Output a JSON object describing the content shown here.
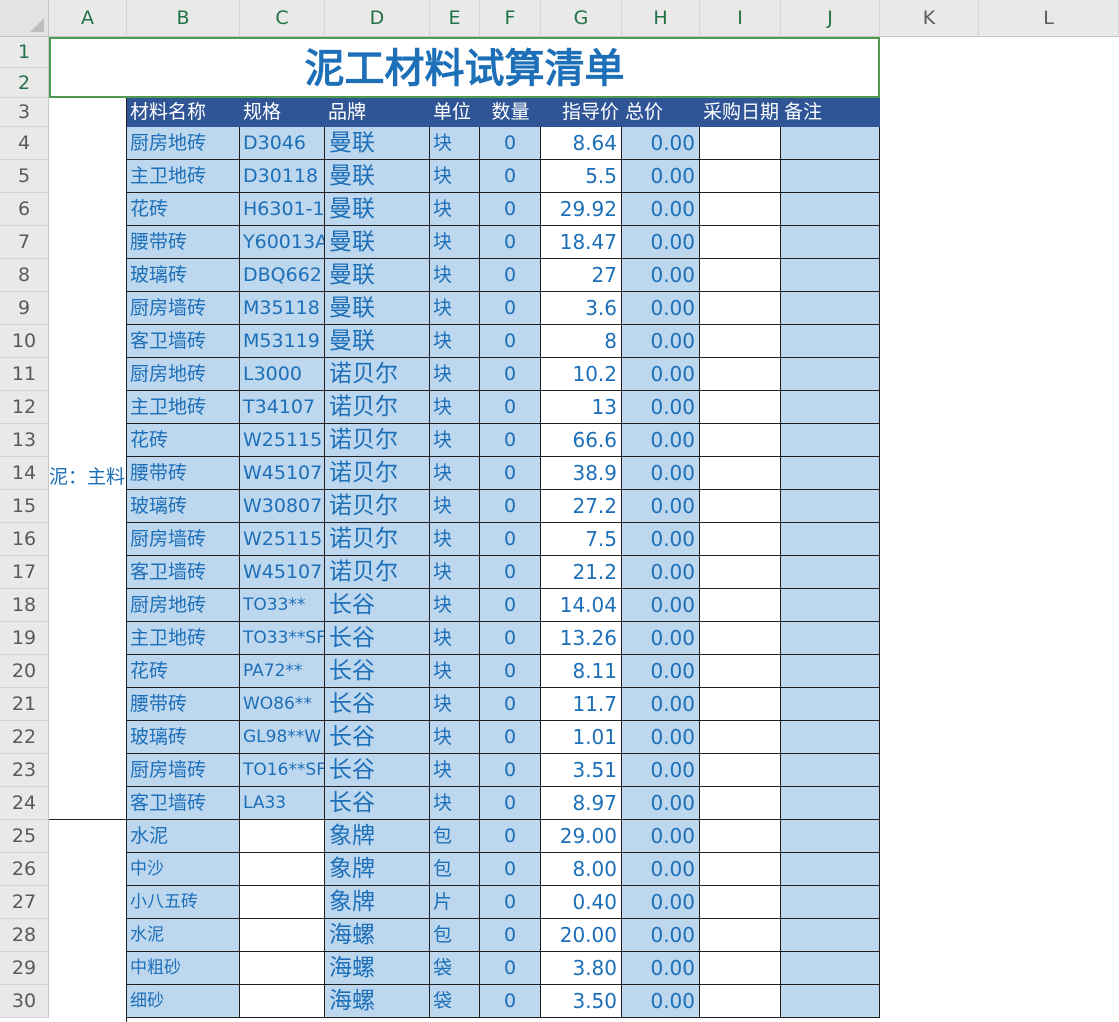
{
  "columns": [
    "A",
    "B",
    "C",
    "D",
    "E",
    "F",
    "G",
    "H",
    "I",
    "J",
    "K",
    "L"
  ],
  "row_numbers": [
    "1",
    "2",
    "3",
    "4",
    "5",
    "6",
    "7",
    "8",
    "9",
    "10",
    "11",
    "12",
    "13",
    "14",
    "15",
    "16",
    "17",
    "18",
    "19",
    "20",
    "21",
    "22",
    "23",
    "24",
    "25",
    "26",
    "27",
    "28",
    "29",
    "30"
  ],
  "sheet_title": "泥工材料试算清单",
  "headers": [
    "材料名称",
    "规格",
    "品牌",
    "单位",
    "数量",
    "指导价",
    "总价",
    "采购日期",
    "备注"
  ],
  "side_label": "泥：主料",
  "rows": [
    {
      "name": "厨房地砖",
      "spec": "D3046",
      "brand": "曼联",
      "unit": "块",
      "qty": "0",
      "price": "8.64",
      "total": "0.00"
    },
    {
      "name": "主卫地砖",
      "spec": "D30118",
      "brand": "曼联",
      "unit": "块",
      "qty": "0",
      "price": "5.5",
      "total": "0.00"
    },
    {
      "name": "花砖",
      "spec": "H6301-1",
      "brand": "曼联",
      "unit": "块",
      "qty": "0",
      "price": "29.92",
      "total": "0.00"
    },
    {
      "name": "腰带砖",
      "spec": "Y60013A",
      "brand": "曼联",
      "unit": "块",
      "qty": "0",
      "price": "18.47",
      "total": "0.00"
    },
    {
      "name": "玻璃砖",
      "spec": "DBQ662",
      "brand": "曼联",
      "unit": "块",
      "qty": "0",
      "price": "27",
      "total": "0.00"
    },
    {
      "name": "厨房墙砖",
      "spec": "M35118",
      "brand": "曼联",
      "unit": "块",
      "qty": "0",
      "price": "3.6",
      "total": "0.00"
    },
    {
      "name": "客卫墙砖",
      "spec": "M53119",
      "brand": "曼联",
      "unit": "块",
      "qty": "0",
      "price": "8",
      "total": "0.00"
    },
    {
      "name": "厨房地砖",
      "spec": "L3000",
      "brand": "诺贝尔",
      "unit": "块",
      "qty": "0",
      "price": "10.2",
      "total": "0.00"
    },
    {
      "name": "主卫地砖",
      "spec": "T34107",
      "brand": "诺贝尔",
      "unit": "块",
      "qty": "0",
      "price": "13",
      "total": "0.00"
    },
    {
      "name": "花砖",
      "spec": "W25115",
      "brand": "诺贝尔",
      "unit": "块",
      "qty": "0",
      "price": "66.6",
      "total": "0.00"
    },
    {
      "name": "腰带砖",
      "spec": "W45107",
      "brand": "诺贝尔",
      "unit": "块",
      "qty": "0",
      "price": "38.9",
      "total": "0.00"
    },
    {
      "name": "玻璃砖",
      "spec": "W30807",
      "brand": "诺贝尔",
      "unit": "块",
      "qty": "0",
      "price": "27.2",
      "total": "0.00"
    },
    {
      "name": "厨房墙砖",
      "spec": "W25115",
      "brand": "诺贝尔",
      "unit": "块",
      "qty": "0",
      "price": "7.5",
      "total": "0.00"
    },
    {
      "name": "客卫墙砖",
      "spec": "W45107",
      "brand": "诺贝尔",
      "unit": "块",
      "qty": "0",
      "price": "21.2",
      "total": "0.00"
    },
    {
      "name": "厨房地砖",
      "spec": "TO33**",
      "brand": "长谷",
      "unit": "块",
      "qty": "0",
      "price": "14.04",
      "total": "0.00"
    },
    {
      "name": "主卫地砖",
      "spec": "TO33**SF",
      "brand": "长谷",
      "unit": "块",
      "qty": "0",
      "price": "13.26",
      "total": "0.00"
    },
    {
      "name": "花砖",
      "spec": "PA72**",
      "brand": "长谷",
      "unit": "块",
      "qty": "0",
      "price": "8.11",
      "total": "0.00"
    },
    {
      "name": "腰带砖",
      "spec": "WO86**",
      "brand": "长谷",
      "unit": "块",
      "qty": "0",
      "price": "11.7",
      "total": "0.00"
    },
    {
      "name": "玻璃砖",
      "spec": "GL98**W",
      "brand": "长谷",
      "unit": "块",
      "qty": "0",
      "price": "1.01",
      "total": "0.00"
    },
    {
      "name": "厨房墙砖",
      "spec": "TO16**SF",
      "brand": "长谷",
      "unit": "块",
      "qty": "0",
      "price": "3.51",
      "total": "0.00"
    },
    {
      "name": "客卫墙砖",
      "spec": "LA33",
      "brand": "长谷",
      "unit": "块",
      "qty": "0",
      "price": "8.97",
      "total": "0.00"
    },
    {
      "name": "水泥",
      "spec": "",
      "brand": "象牌",
      "unit": "包",
      "qty": "0",
      "price": "29.00",
      "total": "0.00"
    },
    {
      "name": "中沙",
      "spec": "",
      "brand": "象牌",
      "unit": "包",
      "qty": "0",
      "price": "8.00",
      "total": "0.00"
    },
    {
      "name": "小八五砖",
      "spec": "",
      "brand": "象牌",
      "unit": "片",
      "qty": "0",
      "price": "0.40",
      "total": "0.00"
    },
    {
      "name": "水泥",
      "spec": "",
      "brand": "海螺",
      "unit": "包",
      "qty": "0",
      "price": "20.00",
      "total": "0.00"
    },
    {
      "name": "中粗砂",
      "spec": "",
      "brand": "海螺",
      "unit": "袋",
      "qty": "0",
      "price": "3.80",
      "total": "0.00"
    },
    {
      "name": "细砂",
      "spec": "",
      "brand": "海螺",
      "unit": "袋",
      "qty": "0",
      "price": "3.50",
      "total": "0.00"
    }
  ],
  "colors": {
    "header_bg": "#2f5597",
    "cell_blue": "#bdd7ee",
    "text_blue": "#1d6fb8",
    "selection_green": "#4f9a4f"
  }
}
